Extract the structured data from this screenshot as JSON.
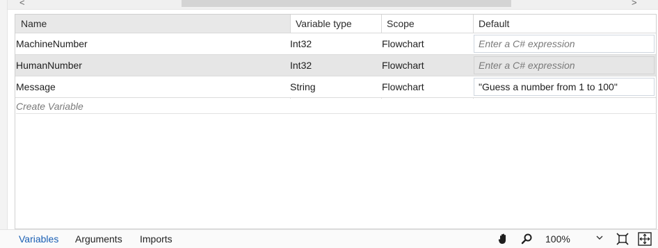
{
  "scrollbar": {
    "left_arrow": "<",
    "right_arrow": ">"
  },
  "grid": {
    "headers": [
      "Name",
      "Variable type",
      "Scope",
      "Default"
    ],
    "rows": [
      {
        "name": "MachineNumber",
        "type": "Int32",
        "scope": "Flowchart",
        "default": "",
        "default_placeholder": "Enter a C# expression"
      },
      {
        "name": "HumanNumber",
        "type": "Int32",
        "scope": "Flowchart",
        "default": "",
        "default_placeholder": "Enter a C# expression",
        "selected": true
      },
      {
        "name": "Message",
        "type": "String",
        "scope": "Flowchart",
        "default": "\"Guess a number from 1 to 100\"",
        "default_placeholder": ""
      }
    ],
    "create_variable": "Create Variable"
  },
  "bottom": {
    "tabs": [
      "Variables",
      "Arguments",
      "Imports"
    ],
    "active_tab": "Variables",
    "zoom": "100%",
    "icons": [
      "hand-icon",
      "magnifier-icon",
      "chevron-down-icon",
      "fit-to-screen-icon",
      "overview-icon"
    ]
  },
  "colors": {
    "accent": "#1a5fb4",
    "selected_row": "#e6e6e6"
  }
}
